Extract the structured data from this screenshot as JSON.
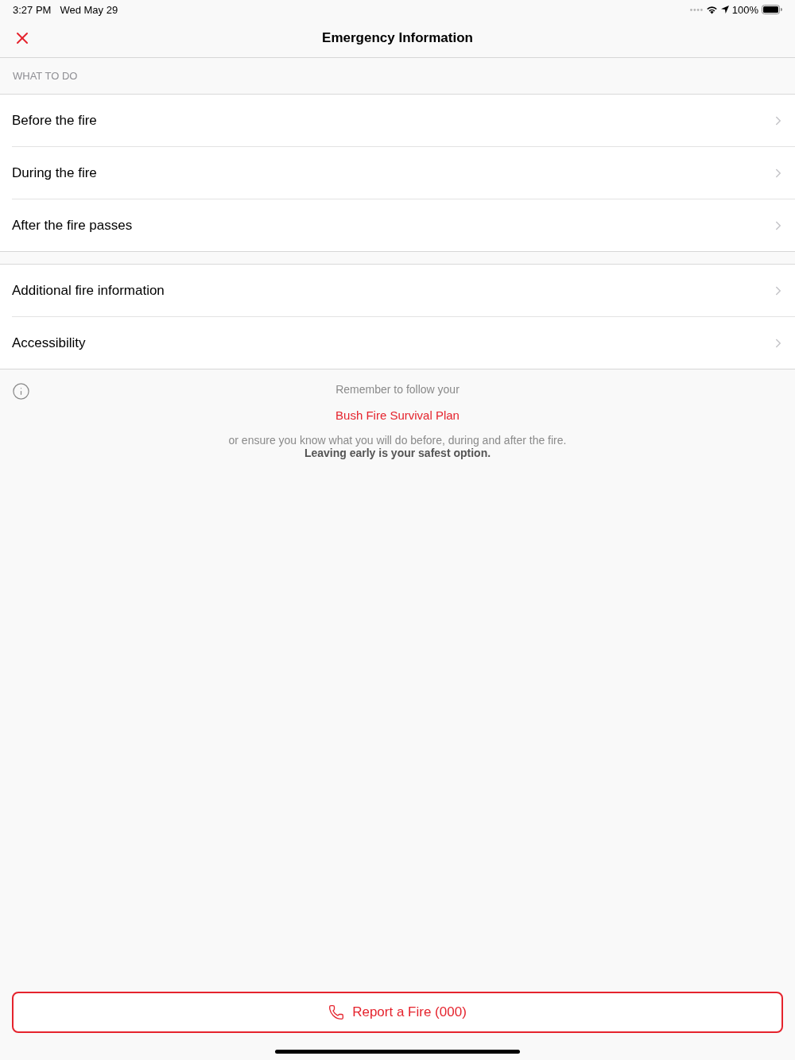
{
  "status_bar": {
    "time": "3:27 PM",
    "date": "Wed May 29",
    "battery": "100%"
  },
  "nav_bar": {
    "title": "Emergency Information"
  },
  "sections": [
    {
      "header": "WHAT TO DO",
      "items": [
        {
          "label": "Before the fire"
        },
        {
          "label": "During the fire"
        },
        {
          "label": "After the fire passes"
        }
      ]
    },
    {
      "items": [
        {
          "label": "Additional fire information"
        },
        {
          "label": "Accessibility"
        }
      ]
    }
  ],
  "notice": {
    "intro": "Remember to follow your",
    "link": "Bush Fire Survival Plan",
    "body": "or ensure you know what you will do before, during and after the fire.",
    "emphasis": "Leaving early is your safest option."
  },
  "report_button": {
    "label": "Report a Fire (000)"
  }
}
